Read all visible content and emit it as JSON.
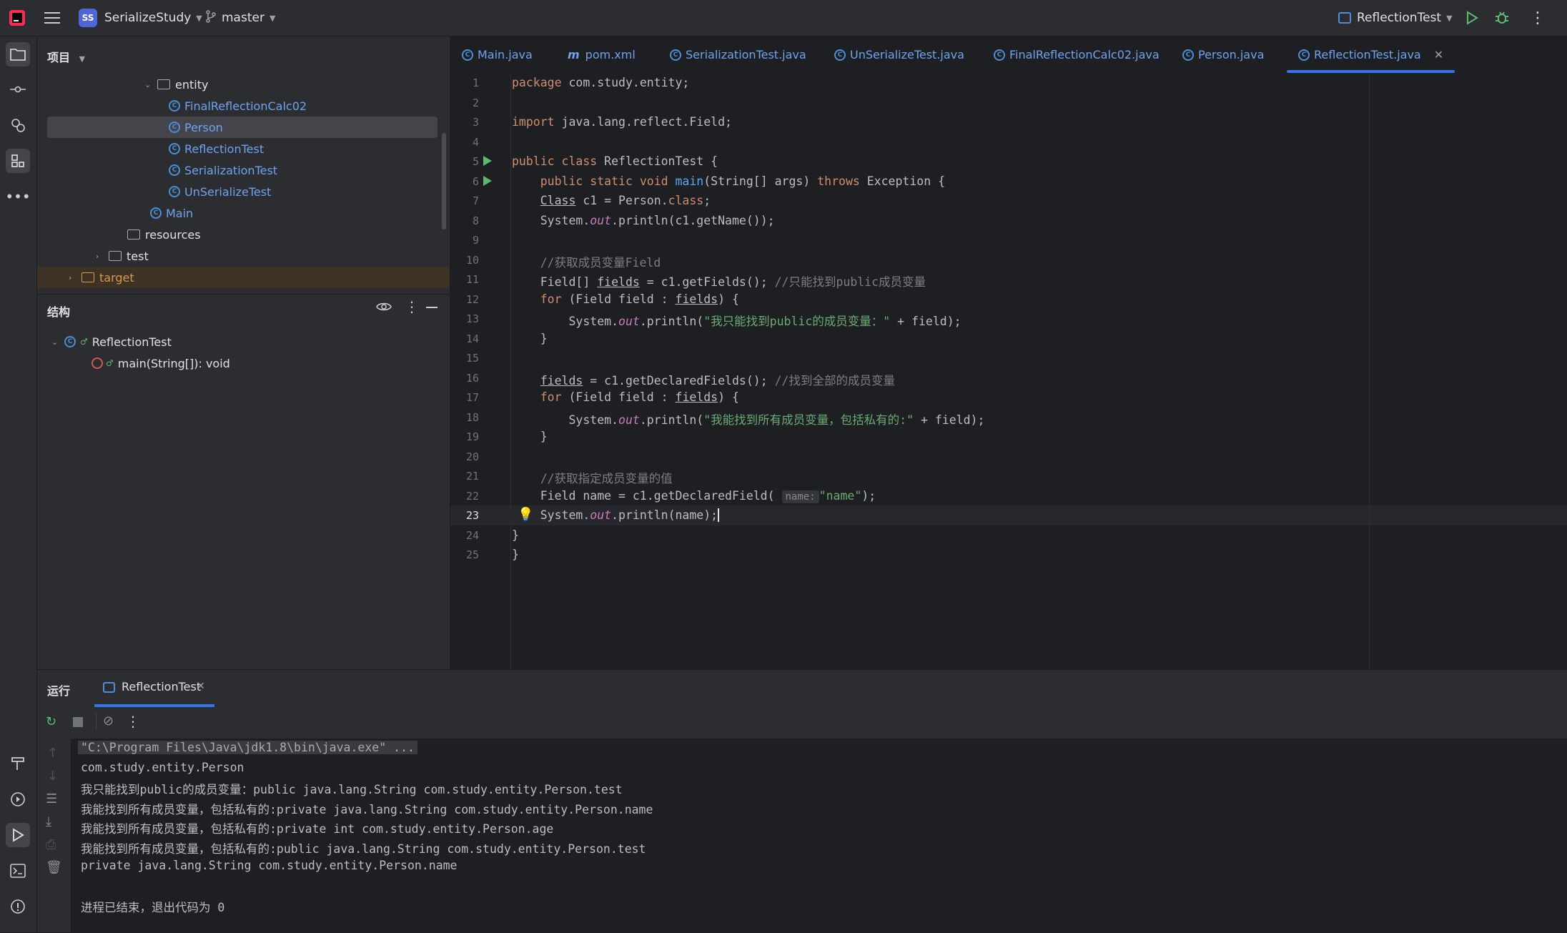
{
  "titlebar": {
    "project_badge": "SS",
    "project_name": "SerializeStudy",
    "branch": "master",
    "run_config": "ReflectionTest"
  },
  "project_panel": {
    "title": "项目",
    "tree": [
      {
        "label": "entity",
        "kind": "package",
        "expanded": true
      },
      {
        "label": "FinalReflectionCalc02",
        "kind": "class"
      },
      {
        "label": "Person",
        "kind": "class",
        "selected": true
      },
      {
        "label": "ReflectionTest",
        "kind": "class"
      },
      {
        "label": "SerializationTest",
        "kind": "class"
      },
      {
        "label": "UnSerializeTest",
        "kind": "class"
      },
      {
        "label": "Main",
        "kind": "class"
      },
      {
        "label": "resources",
        "kind": "folder"
      },
      {
        "label": "test",
        "kind": "folder"
      },
      {
        "label": "target",
        "kind": "folder-excluded"
      }
    ]
  },
  "structure_panel": {
    "title": "结构",
    "root": "ReflectionTest",
    "member": "main(String[]): void"
  },
  "tabs": [
    {
      "label": "Main.java",
      "icon": "class-icon"
    },
    {
      "label": "pom.xml",
      "icon": "maven-icon"
    },
    {
      "label": "SerializationTest.java",
      "icon": "class-icon"
    },
    {
      "label": "UnSerializeTest.java",
      "icon": "class-icon"
    },
    {
      "label": "FinalReflectionCalc02.java",
      "icon": "class-icon"
    },
    {
      "label": "Person.java",
      "icon": "class-icon"
    },
    {
      "label": "ReflectionTest.java",
      "icon": "class-icon",
      "active": true
    }
  ],
  "editor": {
    "line_numbers": [
      "1",
      "2",
      "3",
      "4",
      "5",
      "6",
      "7",
      "8",
      "9",
      "10",
      "11",
      "12",
      "13",
      "14",
      "15",
      "16",
      "17",
      "18",
      "19",
      "20",
      "21",
      "22",
      "23",
      "24",
      "25"
    ],
    "current_line": "23",
    "param_hint": "name:"
  },
  "run_panel": {
    "title": "运行",
    "tab_label": "ReflectionTest",
    "output": [
      "\"C:\\Program Files\\Java\\jdk1.8\\bin\\java.exe\" ...",
      "com.study.entity.Person",
      "我只能找到public的成员变量：public java.lang.String com.study.entity.Person.test",
      "我能找到所有成员变量，包括私有的:private java.lang.String com.study.entity.Person.name",
      "我能找到所有成员变量，包括私有的:private int com.study.entity.Person.age",
      "我能找到所有成员变量，包括私有的:public java.lang.String com.study.entity.Person.test",
      "private java.lang.String com.study.entity.Person.name",
      "",
      "进程已结束，退出代码为 0"
    ]
  },
  "colors": {
    "accent": "#3574f0",
    "keyword": "#cf8e6d",
    "string": "#6aab73",
    "comment": "#7a7e85",
    "class_blue": "#6fa3f0"
  }
}
